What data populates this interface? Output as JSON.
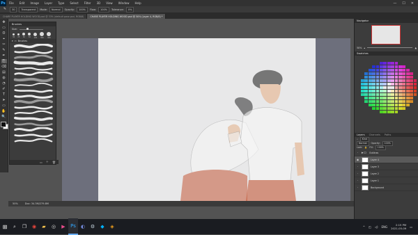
{
  "menubar": {
    "app_badge": "Ps",
    "items": [
      "File",
      "Edit",
      "Image",
      "Layer",
      "Type",
      "Select",
      "Filter",
      "3D",
      "View",
      "Window",
      "Help"
    ],
    "controls": [
      "—",
      "☐",
      "✕"
    ]
  },
  "options": {
    "brush_size": "30",
    "preset_label": "Transparent",
    "mode_label": "Mode:",
    "mode_value": "Normal",
    "opacity_label": "Opacity:",
    "opacity_value": "100%",
    "flow_label": "Flow:",
    "flow_value": "100%",
    "tolerance_label": "Tolerance:",
    "tolerance_value": "0%"
  },
  "tabs": [
    {
      "label": "CHARE PLAYER HOLDING WOOD.psd @ 33% (default pose.psd, RGB/8)",
      "active": false
    },
    {
      "label": "CHARE PLAYER HOLDING WOOD.psd @ 50% (Layer 4, RGB/8) *",
      "active": true
    }
  ],
  "tools": [
    "✥",
    "▭",
    "ʘ",
    "⌖",
    "✂",
    "✎",
    "✒",
    "⎘",
    "⌫",
    "▤",
    "◍",
    "◔",
    "✐",
    "T",
    "➤",
    "▭",
    "✋",
    "🔍"
  ],
  "brushes": {
    "title": "Brushes",
    "size_label": "Size:",
    "presets": [
      {
        "size": "30",
        "d": 3
      },
      {
        "size": "25",
        "d": 3
      },
      {
        "size": "30",
        "d": 4
      },
      {
        "size": "50",
        "d": 4
      },
      {
        "size": "100",
        "d": 5
      },
      {
        "size": "300",
        "d": 6
      },
      {
        "size": "400",
        "d": 6
      }
    ],
    "folder_label": "Brushes"
  },
  "status": {
    "zoom": "50%",
    "doc": "Doc: 34.3M/279.8M"
  },
  "navigator": {
    "title": "Navigator",
    "zoom": "50%"
  },
  "swatches": {
    "tab_title": "Swatches"
  },
  "layers": {
    "tabs": [
      "Layers",
      "Channels",
      "Paths"
    ],
    "kind_label": "Kind",
    "blend": "Normal",
    "opacity_label": "Opacity:",
    "opacity": "100%",
    "lock_label": "Lock:",
    "fill_label": "Fill:",
    "fill": "100%",
    "rows": [
      {
        "name": "Outlines",
        "folder": true,
        "visible": false,
        "selected": false
      },
      {
        "name": "Layer 4",
        "folder": false,
        "visible": true,
        "selected": true
      },
      {
        "name": "Layer 3",
        "folder": false,
        "visible": false,
        "selected": false
      },
      {
        "name": "Layer 2",
        "folder": false,
        "visible": false,
        "selected": false
      },
      {
        "name": "Layer 1",
        "folder": false,
        "visible": false,
        "selected": false
      },
      {
        "name": "Background",
        "folder": false,
        "visible": false,
        "selected": false
      }
    ]
  },
  "taskbar": {
    "start_icon": "windows-start",
    "lang": "ENG",
    "time": "2:15 PM",
    "date": "2021-05-09"
  },
  "colors": {
    "canvas_bg": "#e8e8e9",
    "work_bg": "#6d6f7c",
    "accent": "#31a8ff",
    "shirt": "#f7f7f7",
    "pants": "#c55a3a",
    "hair": "#2b2b2b",
    "skin": "#e7b48c"
  }
}
